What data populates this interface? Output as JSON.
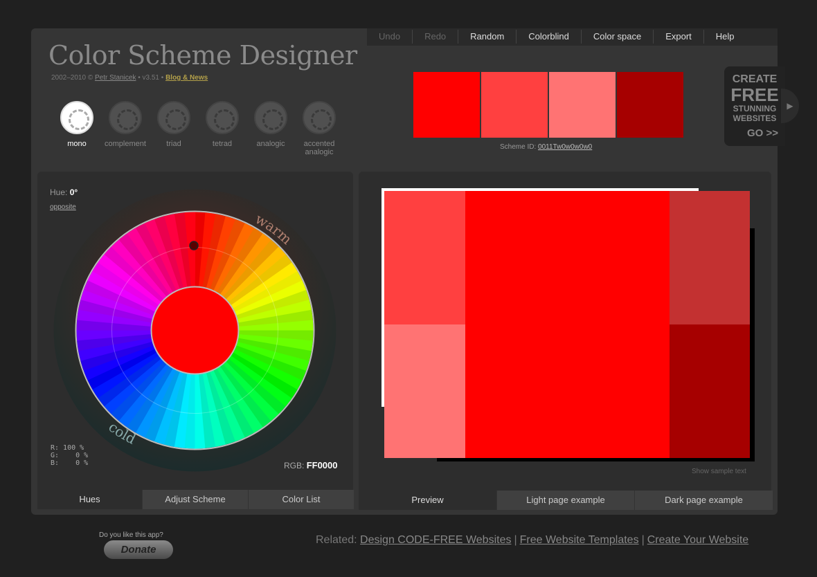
{
  "menu": [
    "Undo",
    "Redo",
    "Random",
    "Colorblind",
    "Color space",
    "Export",
    "Help"
  ],
  "header": {
    "title": "Color Scheme Designer",
    "credits_prefix": "2002–2010 ©",
    "author": "Petr Stanicek",
    "version": "• v3.51 •",
    "blog": "Blog & News"
  },
  "schemes": [
    {
      "label": "mono"
    },
    {
      "label": "complement"
    },
    {
      "label": "triad"
    },
    {
      "label": "tetrad"
    },
    {
      "label": "analogic"
    },
    {
      "label": "accented analogic"
    }
  ],
  "swatches": [
    "#FF0000",
    "#FF4040",
    "#FF7373",
    "#A60000"
  ],
  "scheme_id": {
    "label": "Scheme ID:",
    "value": "0011Tw0w0w0w0"
  },
  "ad": {
    "l1": "CREATE",
    "l2": "FREE",
    "l3": "STUNNING",
    "l4": "WEBSITES",
    "l5": "GO >>"
  },
  "hue": {
    "label": "Hue:",
    "value": "0°",
    "opposite": "opposite"
  },
  "wheel": {
    "warm": "warm",
    "cold": "cold",
    "center_color": "#FF0000"
  },
  "rgb": {
    "r": "R: 100 %",
    "g": "G:    0 %",
    "b": "B:    0 %",
    "hex_label": "RGB:",
    "hex": "FF0000"
  },
  "left_tabs": [
    "Hues",
    "Adjust Scheme",
    "Color List"
  ],
  "right_tabs": [
    "Preview",
    "Light page example",
    "Dark page example"
  ],
  "show_sample": "Show sample text",
  "donate": {
    "question": "Do you like this app?",
    "button": "Donate"
  },
  "related": {
    "label": "Related:",
    "links": [
      "Design CODE-FREE Websites",
      "Free Website Templates",
      "Create Your Website"
    ]
  }
}
